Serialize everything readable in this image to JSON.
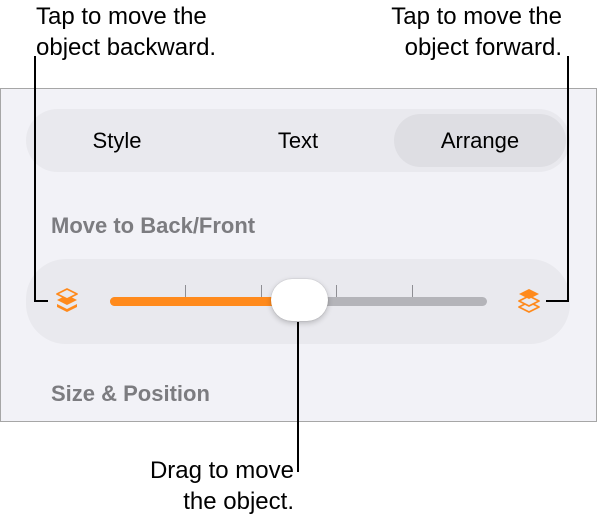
{
  "callouts": {
    "backward": [
      "Tap to move the",
      "object backward."
    ],
    "forward": [
      "Tap to move the",
      "object forward."
    ],
    "drag": [
      "Drag to move",
      "the object."
    ]
  },
  "tabs": [
    {
      "label": "Style",
      "selected": false
    },
    {
      "label": "Text",
      "selected": false
    },
    {
      "label": "Arrange",
      "selected": true
    }
  ],
  "sections": {
    "move_label": "Move to Back/Front",
    "size_label": "Size & Position"
  },
  "slider": {
    "value": 0.5,
    "ticks": 5,
    "back_icon": "send-backward-icon",
    "front_icon": "bring-forward-icon"
  },
  "colors": {
    "accent": "#ff8a1c",
    "panel_bg": "#f2f2f7",
    "control_bg": "#e9e9ee",
    "selected_segment": "#dedee3",
    "section_label": "#7c7c80"
  }
}
